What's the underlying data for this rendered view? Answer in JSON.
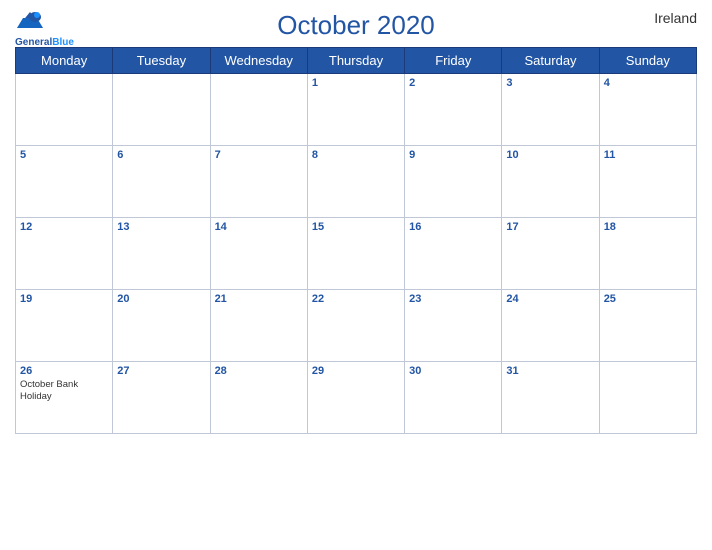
{
  "header": {
    "title": "October 2020",
    "country": "Ireland",
    "logo_general": "General",
    "logo_blue": "Blue"
  },
  "days_of_week": [
    "Monday",
    "Tuesday",
    "Wednesday",
    "Thursday",
    "Friday",
    "Saturday",
    "Sunday"
  ],
  "weeks": [
    [
      {
        "num": "",
        "event": ""
      },
      {
        "num": "",
        "event": ""
      },
      {
        "num": "",
        "event": ""
      },
      {
        "num": "1",
        "event": ""
      },
      {
        "num": "2",
        "event": ""
      },
      {
        "num": "3",
        "event": ""
      },
      {
        "num": "4",
        "event": ""
      }
    ],
    [
      {
        "num": "5",
        "event": ""
      },
      {
        "num": "6",
        "event": ""
      },
      {
        "num": "7",
        "event": ""
      },
      {
        "num": "8",
        "event": ""
      },
      {
        "num": "9",
        "event": ""
      },
      {
        "num": "10",
        "event": ""
      },
      {
        "num": "11",
        "event": ""
      }
    ],
    [
      {
        "num": "12",
        "event": ""
      },
      {
        "num": "13",
        "event": ""
      },
      {
        "num": "14",
        "event": ""
      },
      {
        "num": "15",
        "event": ""
      },
      {
        "num": "16",
        "event": ""
      },
      {
        "num": "17",
        "event": ""
      },
      {
        "num": "18",
        "event": ""
      }
    ],
    [
      {
        "num": "19",
        "event": ""
      },
      {
        "num": "20",
        "event": ""
      },
      {
        "num": "21",
        "event": ""
      },
      {
        "num": "22",
        "event": ""
      },
      {
        "num": "23",
        "event": ""
      },
      {
        "num": "24",
        "event": ""
      },
      {
        "num": "25",
        "event": ""
      }
    ],
    [
      {
        "num": "26",
        "event": "October Bank Holiday"
      },
      {
        "num": "27",
        "event": ""
      },
      {
        "num": "28",
        "event": ""
      },
      {
        "num": "29",
        "event": ""
      },
      {
        "num": "30",
        "event": ""
      },
      {
        "num": "31",
        "event": ""
      },
      {
        "num": "",
        "event": ""
      }
    ]
  ]
}
